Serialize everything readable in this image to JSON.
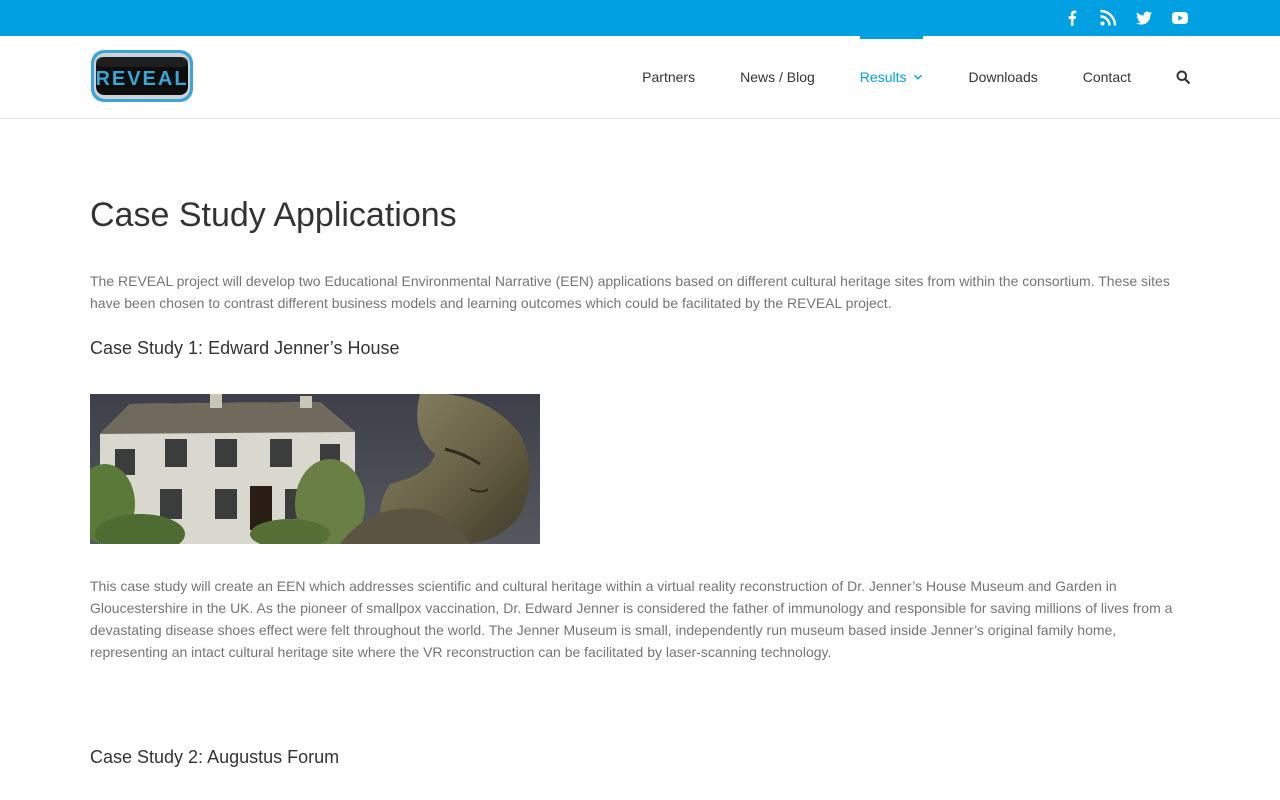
{
  "topbar": {
    "social": [
      "facebook-icon",
      "rss-icon",
      "twitter-icon",
      "youtube-icon"
    ]
  },
  "header": {
    "logo_text": "REVEAL",
    "nav": [
      {
        "label": "Partners"
      },
      {
        "label": "News / Blog"
      },
      {
        "label": "Results"
      },
      {
        "label": "Downloads"
      },
      {
        "label": "Contact"
      }
    ],
    "active_nav": "Results"
  },
  "main": {
    "title": "Case Study Applications",
    "intro": "The REVEAL project will develop two Educational Environmental Narrative (EEN) applications based on different cultural heritage sites from within the consortium. These sites have been chosen to contrast different business models and learning outcomes which could be facilitated by the REVEAL project.",
    "case1_title": "Case Study 1: Edward Jenner’s House",
    "case1_text": "This case study will create an EEN which addresses scientific and cultural heritage within a virtual reality reconstruction of Dr. Jenner’s House Museum and Garden in Gloucestershire in the UK. As the pioneer of smallpox vaccination, Dr. Edward Jenner is considered the father of immunology and responsible for saving millions of lives from a devastating disease shoes effect were felt throughout the world. The Jenner Museum is small, independently run museum based inside Jenner’s original family home, representing an intact cultural heritage site where the VR reconstruction can be facilitated by laser-scanning technology.",
    "case2_title": "Case Study 2: Augustus Forum"
  },
  "colors": {
    "accent": "#00a0e3",
    "heading": "#333333",
    "body": "#747474"
  }
}
